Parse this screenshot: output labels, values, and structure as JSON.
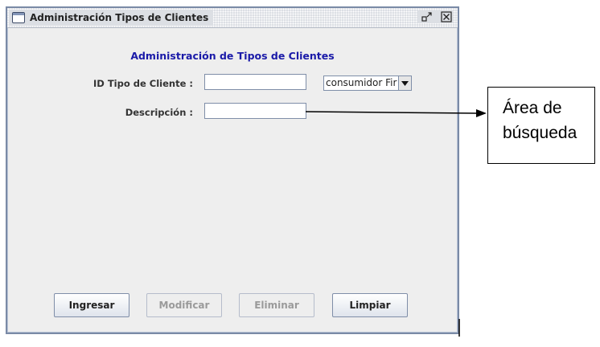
{
  "window": {
    "title": "Administración Tipos de Clientes",
    "icons": [
      "window-icon",
      "restore-icon",
      "close-icon"
    ]
  },
  "form": {
    "heading": "Administración de Tipos de Clientes",
    "id_label": "ID Tipo de Cliente :",
    "id_value": "",
    "type_select_value": "consumidor Fir",
    "description_label": "Descripción :",
    "description_value": ""
  },
  "buttons": {
    "ingresar": "Ingresar",
    "modificar": "Modificar",
    "eliminar": "Eliminar",
    "limpiar": "Limpiar"
  },
  "annotation": {
    "line1": "Área de",
    "line2": "búsqueda"
  },
  "colors": {
    "heading": "#1a1aa8",
    "window_border": "#7a8aa6",
    "panel_bg": "#eeeeee"
  }
}
